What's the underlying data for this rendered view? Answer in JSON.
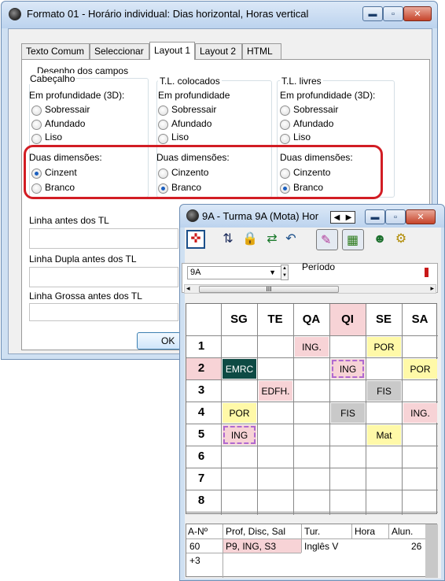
{
  "main_window": {
    "title": "Formato 01 - Horário individual: Dias horizontal, Horas vertical",
    "tabs": [
      "Texto Comum",
      "Seleccionar",
      "Layout 1",
      "Layout 2",
      "HTML"
    ],
    "active_tab": "Layout 1",
    "section_title": "Desenho dos campos",
    "groups": [
      {
        "title": "Cabeçalho",
        "depth_label": "Em profundidade (3D):",
        "depth_options": [
          "Sobressair",
          "Afundado",
          "Liso"
        ],
        "dim_label": "Duas dimensões:",
        "dim_options": [
          "Cinzent",
          "Branco"
        ],
        "dim_selected": "Cinzent"
      },
      {
        "title": "T.L. colocados",
        "depth_label": "Em profundidade",
        "depth_options": [
          "Sobressair",
          "Afundado",
          "Liso"
        ],
        "dim_label": "Duas dimensões:",
        "dim_options": [
          "Cinzento",
          "Branco"
        ],
        "dim_selected": "Branco"
      },
      {
        "title": "T.L. livres",
        "depth_label": "Em profundidade (3D):",
        "depth_options": [
          "Sobressair",
          "Afundado",
          "Liso"
        ],
        "dim_label": "Duas dimensões:",
        "dim_options": [
          "Cinzento",
          "Branco"
        ],
        "dim_selected": "Branco"
      }
    ],
    "fields": [
      "Linha antes dos TL",
      "Linha Dupla antes dos TL",
      "Linha Grossa antes dos TL"
    ],
    "ok_label": "OK"
  },
  "timetable_window": {
    "title": "9A - Turma 9A (Mota)  Hor",
    "combo_value": "9A",
    "period_label": "Período",
    "scroll_thumb": "III",
    "days": [
      "SG",
      "TE",
      "QA",
      "QI",
      "SE",
      "SA"
    ],
    "periods": [
      "1",
      "2",
      "3",
      "4",
      "5",
      "6",
      "7",
      "8"
    ],
    "lessons": [
      {
        "period": 1,
        "day": 3,
        "text": "ING.",
        "bg": "#f7d3d6"
      },
      {
        "period": 1,
        "day": 5,
        "text": "POR",
        "bg": "#fff9a8"
      },
      {
        "period": 2,
        "day": 1,
        "text": "EMRC",
        "bg": "#0d4a44",
        "fg": "#ffffff"
      },
      {
        "period": 2,
        "day": 4,
        "text": "ING",
        "bg": "#f7d3d6",
        "dashed": true
      },
      {
        "period": 2,
        "day": 6,
        "text": "POR",
        "bg": "#fff9a8"
      },
      {
        "period": 3,
        "day": 2,
        "text": "EDFH.",
        "bg": "#f7d3d6"
      },
      {
        "period": 3,
        "day": 5,
        "text": "FIS",
        "bg": "#c9c9c9"
      },
      {
        "period": 4,
        "day": 1,
        "text": "POR",
        "bg": "#fff9a8"
      },
      {
        "period": 4,
        "day": 4,
        "text": "FIS",
        "bg": "#c9c9c9"
      },
      {
        "period": 4,
        "day": 6,
        "text": "ING.",
        "bg": "#f7d3d6"
      },
      {
        "period": 5,
        "day": 1,
        "text": "ING",
        "bg": "#f7d3d6",
        "dashed": true
      },
      {
        "period": 5,
        "day": 5,
        "text": "Mat",
        "bg": "#fff9a8"
      }
    ],
    "list_headers": [
      "A-Nº",
      "Prof, Disc, Sal",
      "Tur.",
      "Hora",
      "Alun."
    ],
    "list_rows": [
      {
        "num": "60",
        "prof": "P9, ING, S3",
        "tur": "Inglês V",
        "hora": "",
        "alun": "26"
      },
      {
        "num": "+3",
        "prof": "",
        "tur": "",
        "hora": "",
        "alun": ""
      }
    ]
  },
  "colors": {
    "highlight_border": "#d21d24",
    "title_bar": "#bcd3ee",
    "pink": "#f7d3d6",
    "yellow": "#fff9a8",
    "gray": "#c9c9c9",
    "dark_teal": "#0d4a44"
  },
  "icons": [
    "app-icon",
    "minimize-icon",
    "maximize-icon",
    "close-icon",
    "arrow-left-icon",
    "arrow-right-icon",
    "move-icon",
    "swap-icon",
    "lock-icon",
    "exchange-icon",
    "undo-icon",
    "color-toggle-icon",
    "view-toggle-icon",
    "people-icon",
    "gears-icon"
  ]
}
